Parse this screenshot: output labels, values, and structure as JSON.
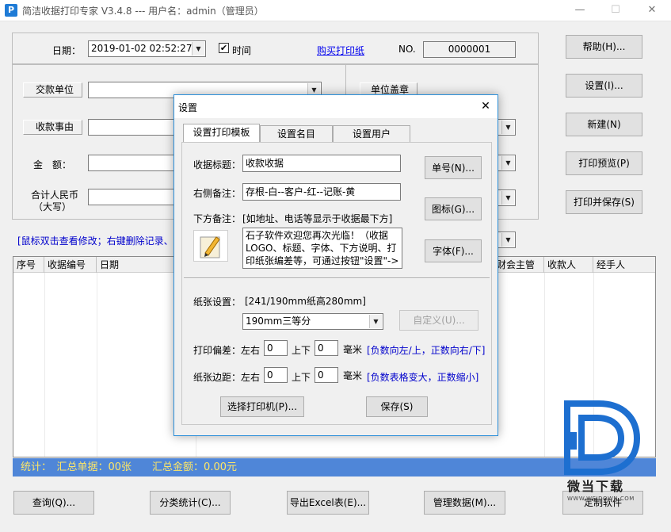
{
  "window": {
    "title": "简洁收据打印专家 V3.4.8 --- 用户名：admin（管理员）",
    "icon_letter": "P",
    "minimize": "—",
    "maximize": "☐",
    "close": "✕"
  },
  "form": {
    "date_label": "日期：",
    "date_value": "2019-01-02 02:52:27",
    "time_checkbox_label": "时间",
    "time_checked": true,
    "buy_paper_link": "购买打印纸",
    "no_label": "NO.",
    "no_value": "0000001",
    "payer_label": "交款单位",
    "payer_value": "",
    "reason_label": "收款事由",
    "amount_label": "金　额：",
    "total_rmb_label_line1": "合计人民币",
    "total_rmb_label_line2": "（大写）",
    "company_seal_label": "单位盖章",
    "hint": "[鼠标双击查看修改；右键删除记录、"
  },
  "side_buttons": [
    "帮助(H)...",
    "设置(I)...",
    "新建(N)",
    "打印预览(P)",
    "打印并保存(S)"
  ],
  "grid": {
    "columns": [
      "序号",
      "收据编号",
      "日期",
      "财会主管",
      "收款人",
      "经手人"
    ]
  },
  "status": {
    "text": "统计：　汇总单据：00张　　汇总金额：0.00元"
  },
  "bottom_buttons": [
    "查询(Q)...",
    "分类统计(C)...",
    "导出Excel表(E)...",
    "管理数据(M)...",
    "定制软件"
  ],
  "watermark": {
    "text": "微当下载",
    "url": "WWW.WEIDOWN.COM"
  },
  "dialog": {
    "title": "设置",
    "tabs": [
      "设置打印模板",
      "设置名目",
      "设置用户"
    ],
    "receipt_title_label": "收据标题：",
    "receipt_title_value": "收款收据",
    "right_note_label": "右侧备注：",
    "right_note_value": "存根-白--客户-红--记账-黄",
    "bottom_note_label": "下方备注：",
    "bottom_note_hint": "[如地址、电话等显示于收据最下方]",
    "bottom_note_line1": "石子软件欢迎您再次光临！（收据",
    "bottom_note_line2": "LOGO、标题、字体、下方说明、打",
    "bottom_note_line3": "印纸张编差等，可通过按钮\"设置\"->",
    "btn_number": "单号(N)...",
    "btn_icon": "图标(G)...",
    "btn_font": "字体(F)...",
    "paper_label": "纸张设置：",
    "paper_info": "[241/190mm纸高280mm]",
    "paper_select": "190mm三等分",
    "btn_custom": "自定义(U)...",
    "offset_label": "打印偏差：",
    "margin_label": "纸张边距：",
    "lr_label": "左右",
    "ud_label": "上下",
    "mm_label": "毫米",
    "offset_lr": "0",
    "offset_ud": "0",
    "margin_lr": "0",
    "margin_ud": "0",
    "offset_hint": "[负数向左/上，正数向右/下]",
    "margin_hint": "[负数表格变大，正数缩小]",
    "btn_printer": "选择打印机(P)...",
    "btn_save": "保存(S)",
    "close": "✕"
  }
}
